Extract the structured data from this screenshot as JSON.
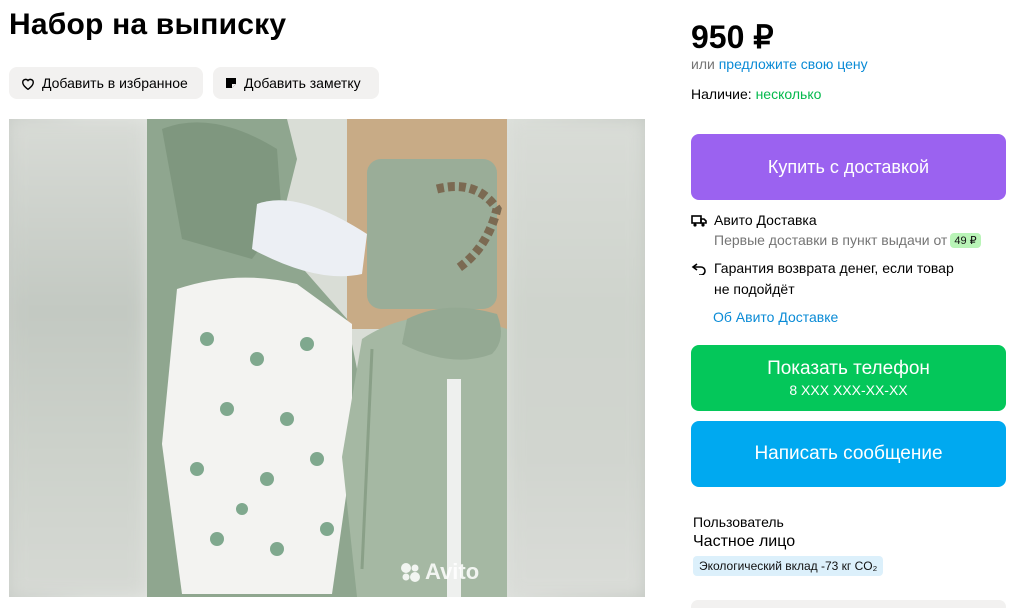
{
  "listing": {
    "title": "Набор на выписку",
    "favorite_label": "Добавить в избранное",
    "note_label": "Добавить заметку",
    "watermark": "Avito"
  },
  "sidebar": {
    "price": "950 ₽",
    "offer_prefix": "или",
    "offer_link": "предложите свою цену",
    "availability_label": "Наличие:",
    "availability_value": "несколько",
    "buy_button": "Купить с доставкой",
    "delivery": {
      "title": "Авито Доставка",
      "subtitle": "Первые доставки в пункт выдачи от",
      "price_badge": "49 ₽",
      "guarantee_line1": "Гарантия возврата денег, если товар",
      "guarantee_line2": "не подойдёт",
      "about_link": "Об Авито Доставке"
    },
    "phone_button": "Показать телефон",
    "phone_masked": "8 XXX XXX-XX-XX",
    "message_button": "Написать сообщение",
    "seller": {
      "name": "Пользователь",
      "type": "Частное лицо",
      "eco_badge": "Экологический вклад -73 кг CO₂"
    }
  },
  "colors": {
    "buy": "#9b62f0",
    "phone": "#04c75a",
    "message": "#00a9f0",
    "link": "#0a8bd6",
    "available": "#04b94d"
  },
  "icons": [
    "heart-icon",
    "note-icon",
    "truck-icon",
    "return-arrow-icon"
  ]
}
